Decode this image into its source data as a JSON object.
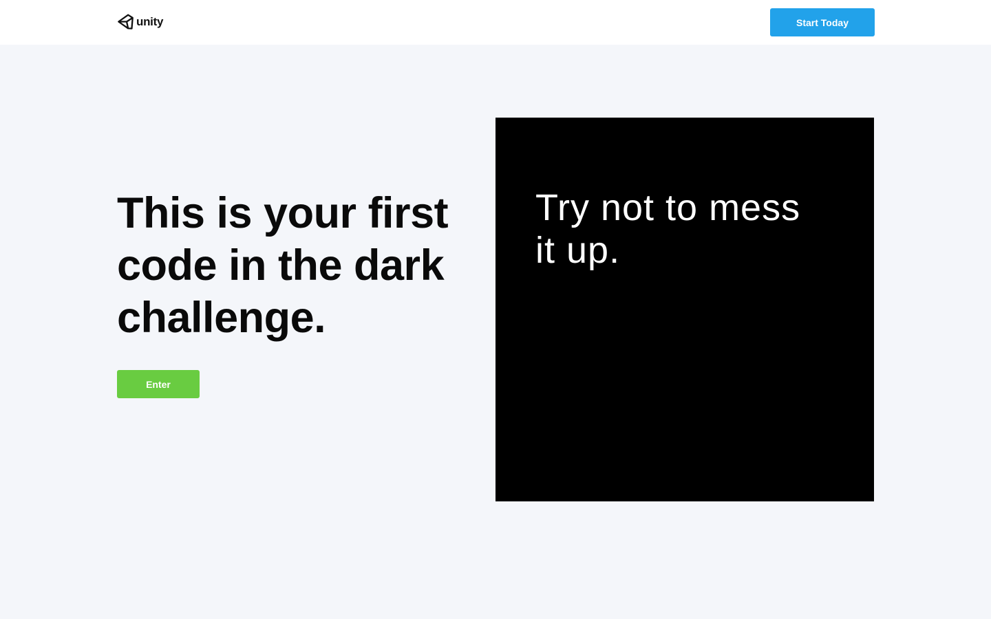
{
  "header": {
    "logo_text": "unity",
    "logo_icon": "unity-cube-icon",
    "start_button_label": "Start Today"
  },
  "hero": {
    "headline": "This is your first code in the dark challenge.",
    "enter_button_label": "Enter"
  },
  "panel": {
    "text": "Try not to mess it up."
  },
  "colors": {
    "header_bg": "#ffffff",
    "page_bg": "#f4f6fa",
    "start_button": "#22a2ea",
    "enter_button": "#69cc41",
    "panel_bg": "#000000"
  }
}
